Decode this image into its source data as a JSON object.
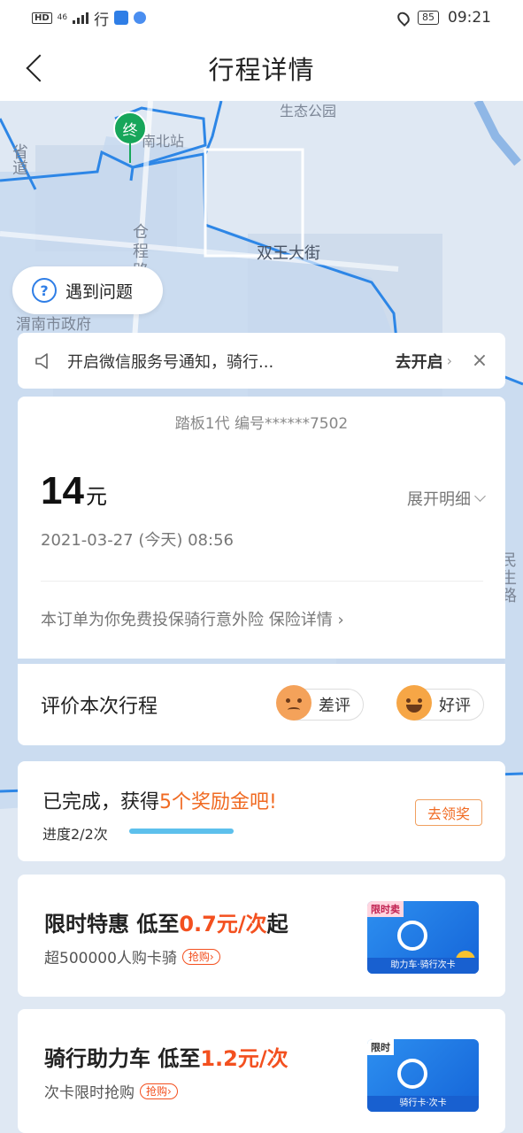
{
  "status_bar": {
    "hd": "HD",
    "net": "46",
    "app_char": "行",
    "battery": "85",
    "time": "09:21"
  },
  "nav": {
    "title": "行程详情"
  },
  "map": {
    "labels": [
      "生态公园",
      "南北站",
      "省道",
      "仓程路",
      "双王大街",
      "渭南市政府",
      "民生路"
    ],
    "end_marker": "终"
  },
  "problem": {
    "icon": "?",
    "label": "遇到问题"
  },
  "notice": {
    "text": "开启微信服务号通知，骑行...",
    "action": "去开启",
    "close": "×"
  },
  "trip": {
    "vehicle": "踏板1代 编号******7502",
    "price": "14",
    "unit": "元",
    "expand": "展开明细",
    "time": "2021-03-27 (今天) 08:56",
    "insurance_text": "本订单为你免费投保骑行意外险 ",
    "insurance_link": "保险详情 ›"
  },
  "rating": {
    "title": "评价本次行程",
    "bad": "差评",
    "good": "好评"
  },
  "reward": {
    "title_prefix": "已完成，获得",
    "title_highlight": "5个奖励金吧!",
    "progress_label": "进度2/2次",
    "progress": 1.0,
    "claim": "去领奖"
  },
  "promos": [
    {
      "title_prefix": "限时特惠  低至",
      "price": "0.7元/次",
      "title_suffix": "起",
      "sub": "超500000人购卡骑",
      "tag": "抢购›",
      "img_badge": "限时卖",
      "img_caption": "助力车·骑行次卡"
    },
    {
      "title_prefix": "骑行助力车  低至",
      "price": "1.2元/次",
      "title_suffix": "",
      "sub": "次卡限时抢购",
      "tag": "抢购›",
      "img_badge": "限时",
      "img_caption": "骑行卡·次卡"
    }
  ],
  "colors": {
    "accent_blue": "#2f7ee6",
    "highlight_orange": "#f06a22",
    "promo_red": "#f3501f",
    "end_green": "#17a65a"
  }
}
